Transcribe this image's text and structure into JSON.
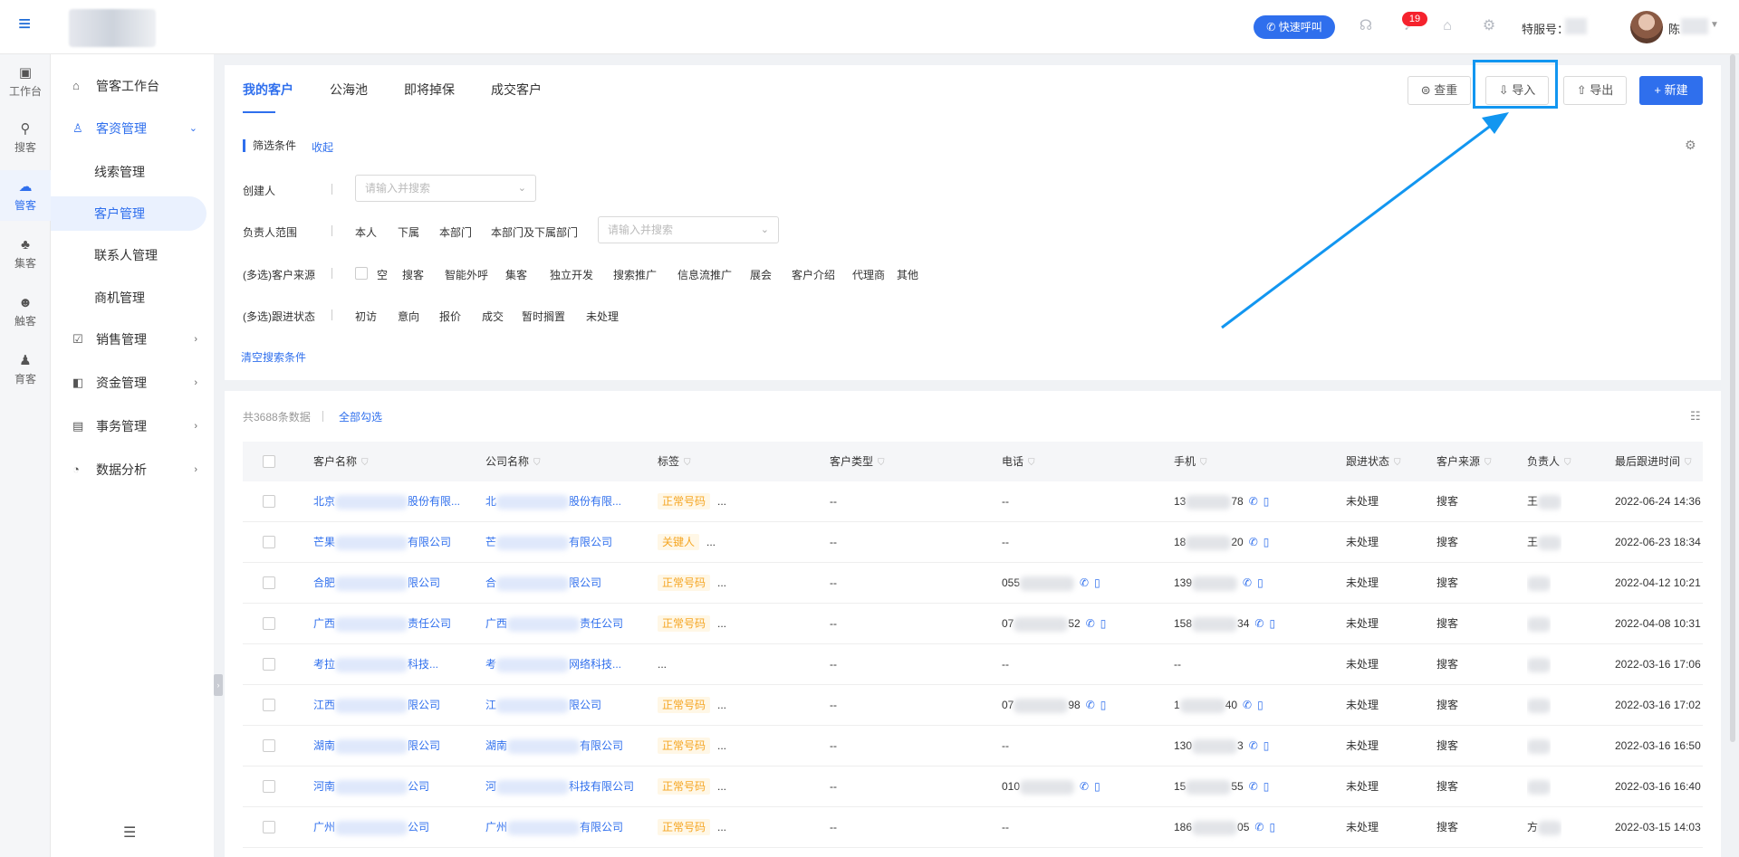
{
  "topbar": {
    "quick_call_label": "快速呼叫",
    "notification_count": "19",
    "service_no_label": "特服号：",
    "user_name": "陈"
  },
  "rail": [
    {
      "label": "工作台",
      "icon": "workbench-icon",
      "glyph": "▣"
    },
    {
      "label": "搜客",
      "icon": "search-customer-icon",
      "glyph": "⚲"
    },
    {
      "label": "管客",
      "icon": "manage-customer-icon",
      "glyph": "☁"
    },
    {
      "label": "集客",
      "icon": "gather-customer-icon",
      "glyph": "♣"
    },
    {
      "label": "触客",
      "icon": "touch-customer-icon",
      "glyph": "☻"
    },
    {
      "label": "育客",
      "icon": "nurture-customer-icon",
      "glyph": "♟"
    }
  ],
  "sidebar": {
    "items": [
      {
        "label": "管客工作台",
        "icon": "home-icon",
        "glyph": "⌂"
      },
      {
        "label": "客资管理",
        "icon": "user-group-icon",
        "glyph": "♙",
        "open": true
      },
      {
        "label": "线索管理"
      },
      {
        "label": "客户管理",
        "active": true
      },
      {
        "label": "联系人管理"
      },
      {
        "label": "商机管理"
      },
      {
        "label": "销售管理",
        "icon": "checklist-icon",
        "glyph": "☑",
        "dot": true
      },
      {
        "label": "资金管理",
        "icon": "wallet-icon",
        "glyph": "◧"
      },
      {
        "label": "事务管理",
        "icon": "calendar-icon",
        "glyph": "▤"
      },
      {
        "label": "数据分析",
        "icon": "pie-chart-icon",
        "glyph": "◔"
      }
    ]
  },
  "tabs": [
    "我的客户",
    "公海池",
    "即将掉保",
    "成交客户"
  ],
  "toolbar": {
    "dedupe_label": "查重",
    "import_label": "导入",
    "export_label": "导出",
    "new_label": "+ 新建"
  },
  "filter": {
    "title": "筛选条件",
    "collapse": "收起",
    "creator_label": "创建人",
    "creator_placeholder": "请输入并搜索",
    "owner_label": "负责人范围",
    "owner_options": [
      "本人",
      "下属",
      "本部门",
      "本部门及下属部门"
    ],
    "owner_placeholder": "请输入并搜索",
    "source_label": "(多选)客户来源",
    "source_options": [
      "空",
      "搜客",
      "智能外呼",
      "集客",
      "独立开发",
      "搜索推广",
      "信息流推广",
      "展会",
      "客户介绍",
      "代理商",
      "其他"
    ],
    "status_label": "(多选)跟进状态",
    "status_options": [
      "初访",
      "意向",
      "报价",
      "成交",
      "暂时搁置",
      "未处理"
    ],
    "clear": "清空搜索条件"
  },
  "table": {
    "total": "共3688条数据",
    "select_all": "全部勾选",
    "columns": [
      "客户名称",
      "公司名称",
      "标签",
      "客户类型",
      "电话",
      "手机",
      "跟进状态",
      "客户来源",
      "负责人",
      "最后跟进时间"
    ],
    "rows": [
      {
        "name_a": "北京",
        "name_b": "股份有限...",
        "company_a": "北",
        "company_b": "股份有限...",
        "tag": "正常号码",
        "tag_more": "...",
        "type": "--",
        "phone_a": "--",
        "phone_b": "",
        "mobile_a": "13",
        "mobile_b": "78",
        "status": "未处理",
        "source": "搜客",
        "owner": "王",
        "time": "2022-06-24 14:36"
      },
      {
        "name_a": "芒果",
        "name_b": "有限公司",
        "company_a": "芒",
        "company_b": "有限公司",
        "tag": "关键人",
        "tag_more": "...",
        "type": "--",
        "phone_a": "--",
        "phone_b": "",
        "mobile_a": "18",
        "mobile_b": "20",
        "status": "未处理",
        "source": "搜客",
        "owner": "王",
        "time": "2022-06-23 18:34"
      },
      {
        "name_a": "合肥",
        "name_b": "限公司",
        "company_a": "合",
        "company_b": "限公司",
        "tag": "正常号码",
        "tag_more": "...",
        "type": "--",
        "phone_a": "055",
        "phone_b": "",
        "mobile_a": "139",
        "mobile_b": "",
        "status": "未处理",
        "source": "搜客",
        "owner": "",
        "time": "2022-04-12 10:21"
      },
      {
        "name_a": "广西",
        "name_b": "责任公司",
        "company_a": "广西",
        "company_b": "责任公司",
        "tag": "正常号码",
        "tag_more": "...",
        "type": "--",
        "phone_a": "07",
        "phone_b": "52",
        "mobile_a": "158",
        "mobile_b": "34",
        "status": "未处理",
        "source": "搜客",
        "owner": "",
        "time": "2022-04-08 10:31"
      },
      {
        "name_a": "考拉",
        "name_b": "科技...",
        "company_a": "考",
        "company_b": "网络科技...",
        "tag": "",
        "tag_more": "...",
        "type": "--",
        "phone_a": "--",
        "phone_b": "",
        "mobile_a": "--",
        "mobile_b": "",
        "status": "未处理",
        "source": "搜客",
        "owner": "",
        "time": "2022-03-16 17:06"
      },
      {
        "name_a": "江西",
        "name_b": "限公司",
        "company_a": "江",
        "company_b": "限公司",
        "tag": "正常号码",
        "tag_more": "...",
        "type": "--",
        "phone_a": "07",
        "phone_b": "98",
        "mobile_a": "1",
        "mobile_b": "40",
        "status": "未处理",
        "source": "搜客",
        "owner": "",
        "time": "2022-03-16 17:02"
      },
      {
        "name_a": "湖南",
        "name_b": "限公司",
        "company_a": "湖南",
        "company_b": "有限公司",
        "tag": "正常号码",
        "tag_more": "...",
        "type": "--",
        "phone_a": "--",
        "phone_b": "",
        "mobile_a": "130",
        "mobile_b": "3",
        "status": "未处理",
        "source": "搜客",
        "owner": "",
        "time": "2022-03-16 16:50"
      },
      {
        "name_a": "河南",
        "name_b": "公司",
        "company_a": "河",
        "company_b": "科技有限公司",
        "tag": "正常号码",
        "tag_more": "...",
        "type": "--",
        "phone_a": "010",
        "phone_b": "",
        "mobile_a": "15",
        "mobile_b": "55",
        "status": "未处理",
        "source": "搜客",
        "owner": "",
        "time": "2022-03-16 16:40"
      },
      {
        "name_a": "广州",
        "name_b": "公司",
        "company_a": "广州",
        "company_b": "有限公司",
        "tag": "正常号码",
        "tag_more": "...",
        "type": "--",
        "phone_a": "--",
        "phone_b": "",
        "mobile_a": "186",
        "mobile_b": "05",
        "status": "未处理",
        "source": "搜客",
        "owner": "方",
        "time": "2022-03-15 14:03"
      }
    ]
  },
  "annotation": {
    "color": "#1296f0"
  }
}
